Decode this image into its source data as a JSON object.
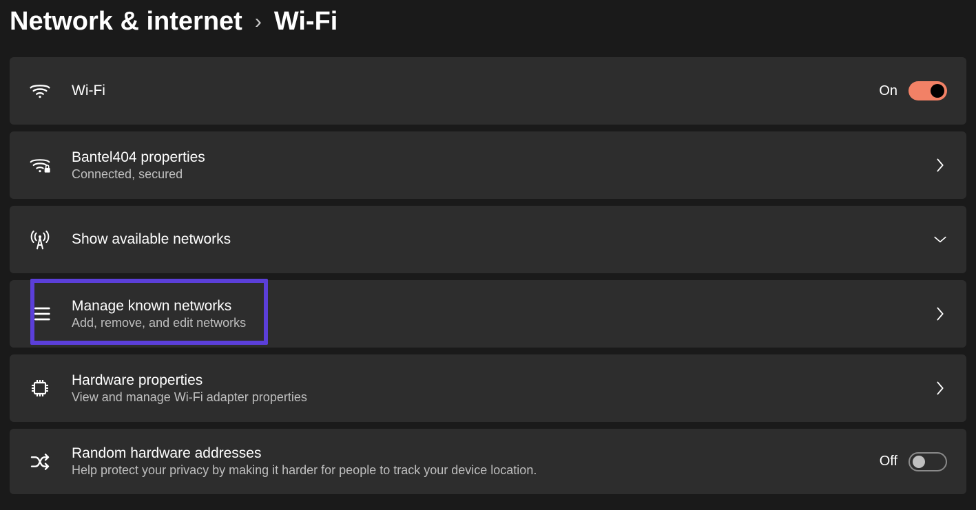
{
  "breadcrumb": {
    "parent": "Network & internet",
    "separator": "›",
    "current": "Wi-Fi"
  },
  "rows": {
    "wifi": {
      "title": "Wi-Fi",
      "toggle_state": "On"
    },
    "network_properties": {
      "title": "Bantel404 properties",
      "subtitle": "Connected, secured"
    },
    "available_networks": {
      "title": "Show available networks"
    },
    "known_networks": {
      "title": "Manage known networks",
      "subtitle": "Add, remove, and edit networks"
    },
    "hardware": {
      "title": "Hardware properties",
      "subtitle": "View and manage Wi-Fi adapter properties"
    },
    "random_mac": {
      "title": "Random hardware addresses",
      "subtitle": "Help protect your privacy by making it harder for people to track your device location.",
      "toggle_state": "Off"
    }
  },
  "colors": {
    "accent": "#f28166",
    "highlight": "#5b3fd9",
    "background": "#1a1a1a",
    "card": "#2d2d2d"
  }
}
